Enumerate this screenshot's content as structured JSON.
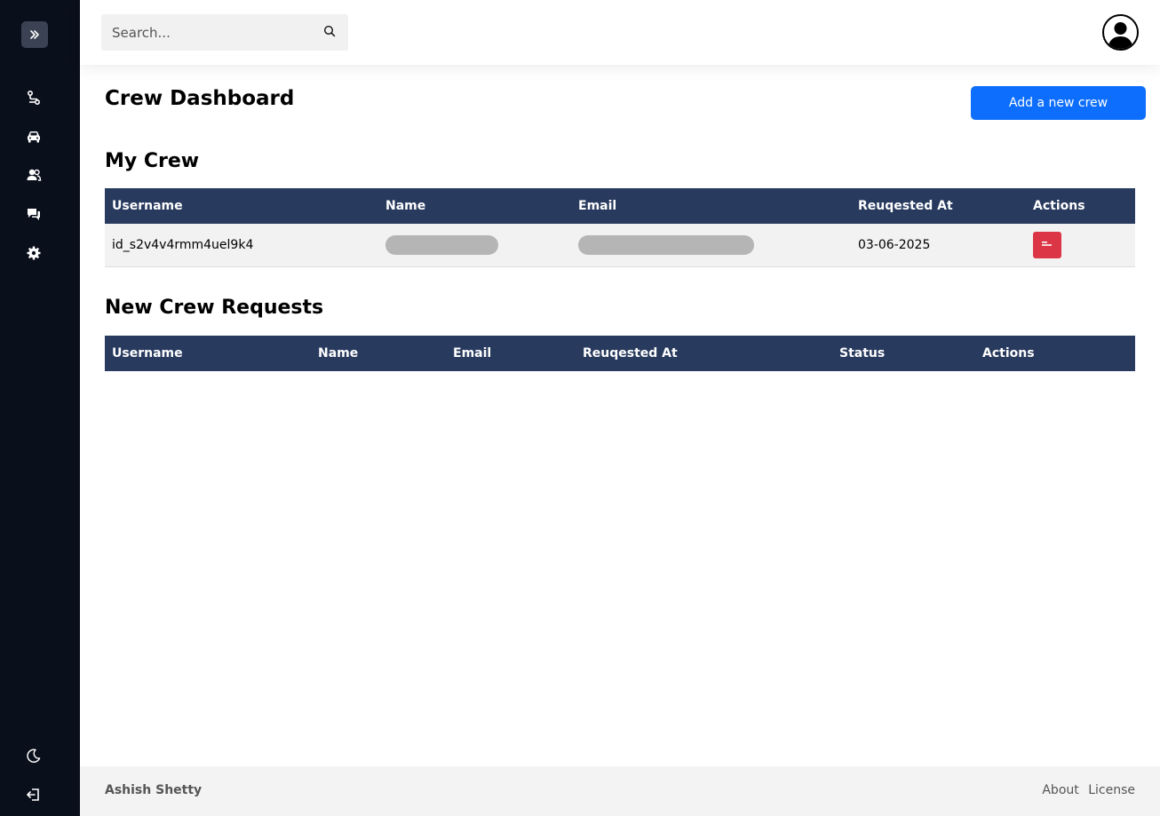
{
  "sidebar": {
    "toggle_icon": "double-chevron-right-icon",
    "items": [
      {
        "icon": "route-icon"
      },
      {
        "icon": "car-icon"
      },
      {
        "icon": "users-icon"
      },
      {
        "icon": "chat-icon"
      },
      {
        "icon": "gear-icon"
      }
    ],
    "bottom_items": [
      {
        "icon": "moon-icon"
      },
      {
        "icon": "logout-icon"
      }
    ]
  },
  "header": {
    "search_placeholder": "Search...",
    "search_icon": "search-icon",
    "avatar_icon": "user-avatar-icon"
  },
  "main": {
    "title": "Crew Dashboard",
    "add_button_label": "Add a new crew",
    "my_crew": {
      "title": "My Crew",
      "columns": [
        "Username",
        "Name",
        "Email",
        "Reuqested At",
        "Actions"
      ],
      "rows": [
        {
          "username": "id_s2v4v4rmm4uel9k4",
          "name": "",
          "email": "",
          "requested_at": "03-06-2025"
        }
      ]
    },
    "requests": {
      "title": "New Crew Requests",
      "columns": [
        "Username",
        "Name",
        "Email",
        "Reuqested At",
        "Status",
        "Actions"
      ],
      "rows": []
    }
  },
  "footer": {
    "author": "Ashish Shetty",
    "about": "About",
    "license": "License"
  },
  "colors": {
    "sidebar_bg": "#0a0f1c",
    "table_header_bg": "#283a5e",
    "primary": "#0d6efd",
    "danger": "#dc3545"
  }
}
